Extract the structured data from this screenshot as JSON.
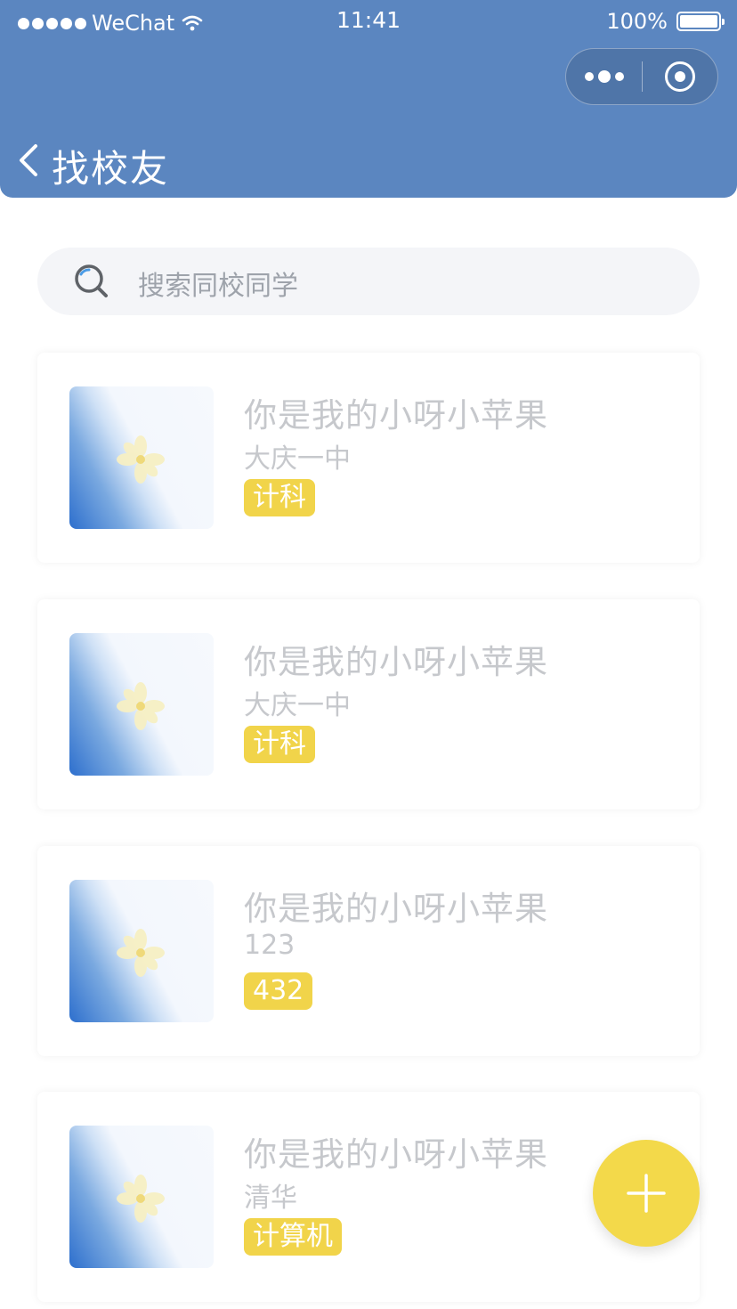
{
  "status_bar": {
    "carrier": "WeChat",
    "time": "11:41",
    "battery": "100%"
  },
  "nav": {
    "title": "找校友",
    "back_icon": "chevron-left-icon",
    "more_icon": "more-dots-icon",
    "close_icon": "target-circle-icon"
  },
  "search": {
    "placeholder": "搜索同校同学",
    "icon": "search-icon"
  },
  "cards": [
    {
      "name": "你是我的小呀小苹果",
      "school": "大庆一中",
      "tag": "计科"
    },
    {
      "name": "你是我的小呀小苹果",
      "school": "大庆一中",
      "tag": "计科"
    },
    {
      "name": "你是我的小呀小苹果",
      "school": "123",
      "tag": "432"
    },
    {
      "name": "你是我的小呀小苹果",
      "school": "清华",
      "tag": "计算机"
    }
  ],
  "fab": {
    "icon": "plus-icon"
  },
  "colors": {
    "header": "#5b86c0",
    "tag": "#f1d44a",
    "fab": "#f3d94a",
    "muted_text": "#c6c8cc",
    "search_bg": "#f4f5f8"
  }
}
